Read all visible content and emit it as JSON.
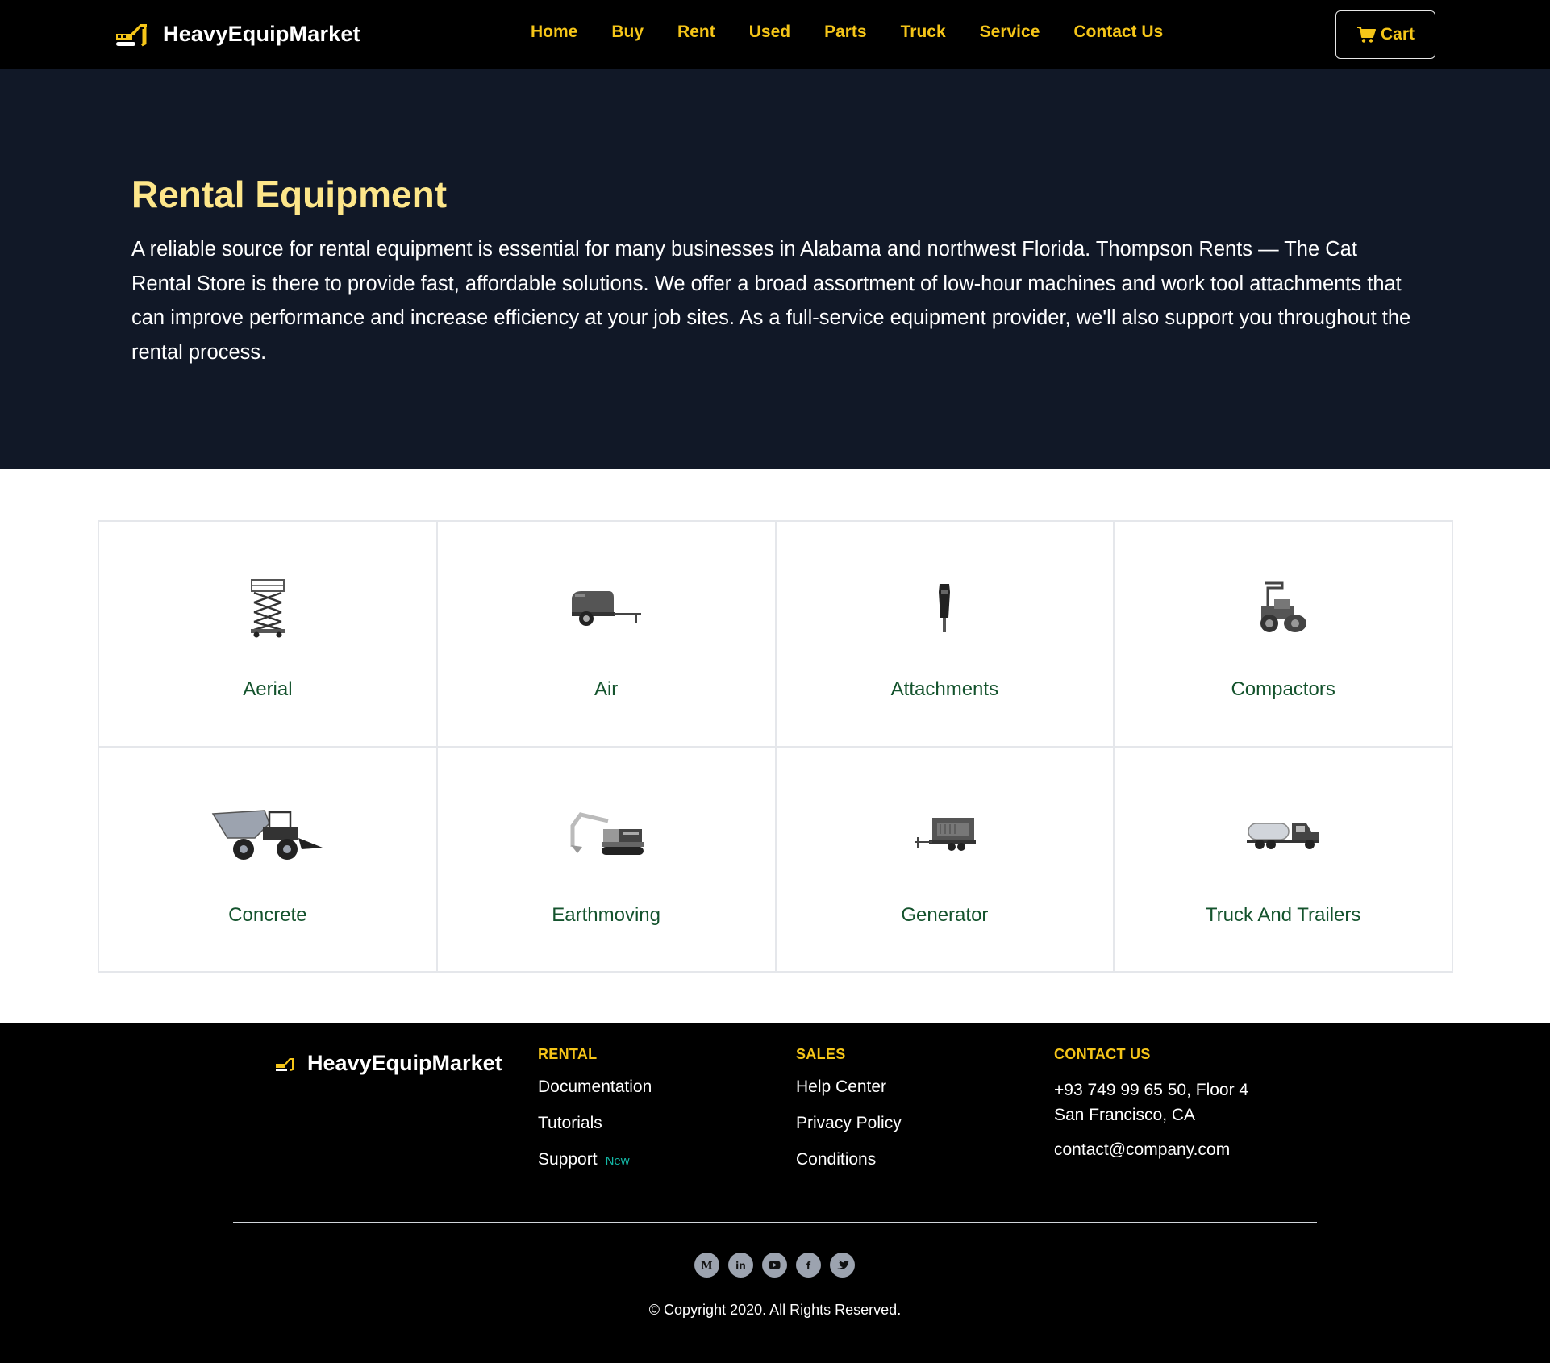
{
  "nav": {
    "brand": "HeavyEquipMarket",
    "links": [
      "Home",
      "Buy",
      "Rent",
      "Used",
      "Parts",
      "Truck",
      "Service",
      "Contact Us"
    ],
    "cart_label": "Cart"
  },
  "hero": {
    "title": "Rental Equipment",
    "text": "A reliable source for rental equipment is essential for many businesses in Alabama and northwest Florida. Thompson Rents — The Cat Rental Store is there to provide fast, affordable solutions. We offer a broad assortment of low-hour machines and work tool attachments that can improve performance and increase efficiency at your job sites. As a full-service equipment provider, we'll also support you throughout the rental process."
  },
  "categories": [
    {
      "label": "Aerial",
      "icon": "scissor-lift-icon"
    },
    {
      "label": "Air",
      "icon": "air-compressor-icon"
    },
    {
      "label": "Attachments",
      "icon": "hammer-attachment-icon"
    },
    {
      "label": "Compactors",
      "icon": "roller-compactor-icon"
    },
    {
      "label": "Concrete",
      "icon": "concrete-buggy-icon"
    },
    {
      "label": "Earthmoving",
      "icon": "excavator-icon"
    },
    {
      "label": "Generator",
      "icon": "generator-icon"
    },
    {
      "label": "Truck And Trailers",
      "icon": "water-truck-icon"
    }
  ],
  "footer": {
    "brand": "HeavyEquipMarket",
    "rental": {
      "heading": "RENTAL",
      "links": [
        "Documentation",
        "Tutorials",
        "Support"
      ],
      "badge": "New"
    },
    "sales": {
      "heading": "SALES",
      "links": [
        "Help Center",
        "Privacy Policy",
        "Conditions"
      ]
    },
    "contact": {
      "heading": "CONTACT US",
      "address_line1": "+93 749 99 65 50, Floor 4",
      "address_line2": "San Francisco, CA",
      "email": "contact@company.com"
    },
    "socials": [
      "medium-icon",
      "linkedin-icon",
      "youtube-icon",
      "facebook-icon",
      "twitter-icon"
    ],
    "copyright": "© Copyright 2020. All Rights Reserved."
  },
  "colors": {
    "accent": "#f5c518",
    "hero_bg": "#111827",
    "hero_title": "#fde68a",
    "card_label": "#14532d",
    "badge": "#14b8a6"
  }
}
